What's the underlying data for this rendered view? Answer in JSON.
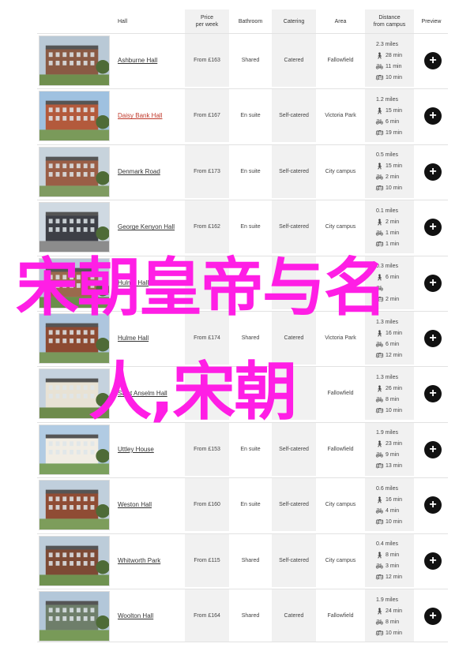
{
  "header": {
    "hall": "Hall",
    "price_line1": "Price",
    "price_line2": "per week",
    "bathroom": "Bathroom",
    "catering": "Catering",
    "area": "Area",
    "distance_line1": "Distance",
    "distance_line2": "from campus",
    "preview": "Preview"
  },
  "rows": [
    {
      "name": "Ashburne Hall",
      "price": "From £163",
      "bathroom": "Shared",
      "catering": "Catered",
      "area": "Fallowfield",
      "miles": "2.3 miles",
      "walk": "28 min",
      "bike": "11 min",
      "bus": "10 min"
    },
    {
      "name": "Daisy Bank Hall",
      "price": "From £167",
      "bathroom": "En suite",
      "catering": "Self-catered",
      "area": "Victoria Park",
      "miles": "1.2 miles",
      "walk": "15 min",
      "bike": "6 min",
      "bus": "19 min"
    },
    {
      "name": "Denmark Road",
      "price": "From £173",
      "bathroom": "En suite",
      "catering": "Self-catered",
      "area": "City campus",
      "miles": "0.5 miles",
      "walk": "15 min",
      "bike": "2 min",
      "bus": "10 min"
    },
    {
      "name": "George Kenyon Hall",
      "price": "From £162",
      "bathroom": "En suite",
      "catering": "Self-catered",
      "area": "City campus",
      "miles": "0.1 miles",
      "walk": "2 min",
      "bike": "1 min",
      "bus": "1 min"
    },
    {
      "name": "Hulme Hall",
      "price": "",
      "bathroom": "",
      "catering": "",
      "area": "",
      "miles": "0.3 miles",
      "walk": "6 min",
      "bike": "",
      "bus": "2 min"
    },
    {
      "name": "Hulme Hall",
      "price": "From £174",
      "bathroom": "Shared",
      "catering": "Catered",
      "area": "Victoria Park",
      "miles": "1.3 miles",
      "walk": "16 min",
      "bike": "6 min",
      "bus": "12 min"
    },
    {
      "name": "Saint Anselm Hall",
      "price": "",
      "bathroom": "",
      "catering": "",
      "area": "Fallowfield",
      "miles": "1.3 miles",
      "walk": "26 min",
      "bike": "8 min",
      "bus": "10 min"
    },
    {
      "name": "Uttley House",
      "price": "From £153",
      "bathroom": "En suite",
      "catering": "Self-catered",
      "area": "Fallowfield",
      "miles": "1.9 miles",
      "walk": "23 min",
      "bike": "9 min",
      "bus": "13 min"
    },
    {
      "name": "Weston Hall",
      "price": "From £160",
      "bathroom": "En suite",
      "catering": "Self-catered",
      "area": "City campus",
      "miles": "0.6 miles",
      "walk": "16 min",
      "bike": "4 min",
      "bus": "10 min"
    },
    {
      "name": "Whitworth Park",
      "price": "From £115",
      "bathroom": "Shared",
      "catering": "Self-catered",
      "area": "City campus",
      "miles": "0.4 miles",
      "walk": "8 min",
      "bike": "3 min",
      "bus": "12 min"
    },
    {
      "name": "Woolton Hall",
      "price": "From £164",
      "bathroom": "Shared",
      "catering": "Catered",
      "area": "Fallowfield",
      "miles": "1.9 miles",
      "walk": "24 min",
      "bike": "8 min",
      "bus": "10 min"
    }
  ],
  "overlay": {
    "line1": "宋朝皇帝与名",
    "line2": "人,宋朝"
  },
  "icons": {
    "walk": "walking-person-icon",
    "bike": "bicycle-icon",
    "bus": "bus-icon",
    "preview": "plus-icon"
  },
  "colors": {
    "link_red": "#c0392b",
    "overlay_magenta": "#ff1ee5",
    "shade": "#f1f1f1"
  }
}
